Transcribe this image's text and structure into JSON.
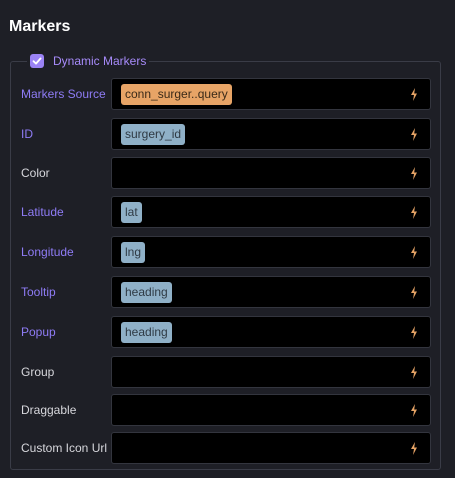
{
  "section": {
    "title": "Markers"
  },
  "group": {
    "checkbox_checked": true,
    "label": "Dynamic Markers"
  },
  "icons": {
    "bolt": "lightning-bolt-icon",
    "check": "checkmark-icon"
  },
  "colors": {
    "accent": "#9b83f5",
    "bound_label": "#8f7cf6",
    "chip_blue": "#8fb0c7",
    "chip_orange": "#e7a466",
    "bolt": "#e7a466"
  },
  "fields": [
    {
      "label": "Markers Source",
      "value": "conn_surger..query",
      "bound": true
    },
    {
      "label": "ID",
      "value": "surgery_id",
      "bound": true
    },
    {
      "label": "Color",
      "value": "",
      "bound": false
    },
    {
      "label": "Latitude",
      "value": "lat",
      "bound": true
    },
    {
      "label": "Longitude",
      "value": "lng",
      "bound": true
    },
    {
      "label": "Tooltip",
      "value": "heading",
      "bound": true
    },
    {
      "label": "Popup",
      "value": "heading",
      "bound": true
    },
    {
      "label": "Group",
      "value": "",
      "bound": false
    },
    {
      "label": "Draggable",
      "value": "",
      "bound": false
    },
    {
      "label": "Custom Icon Url",
      "value": "",
      "bound": false
    }
  ]
}
